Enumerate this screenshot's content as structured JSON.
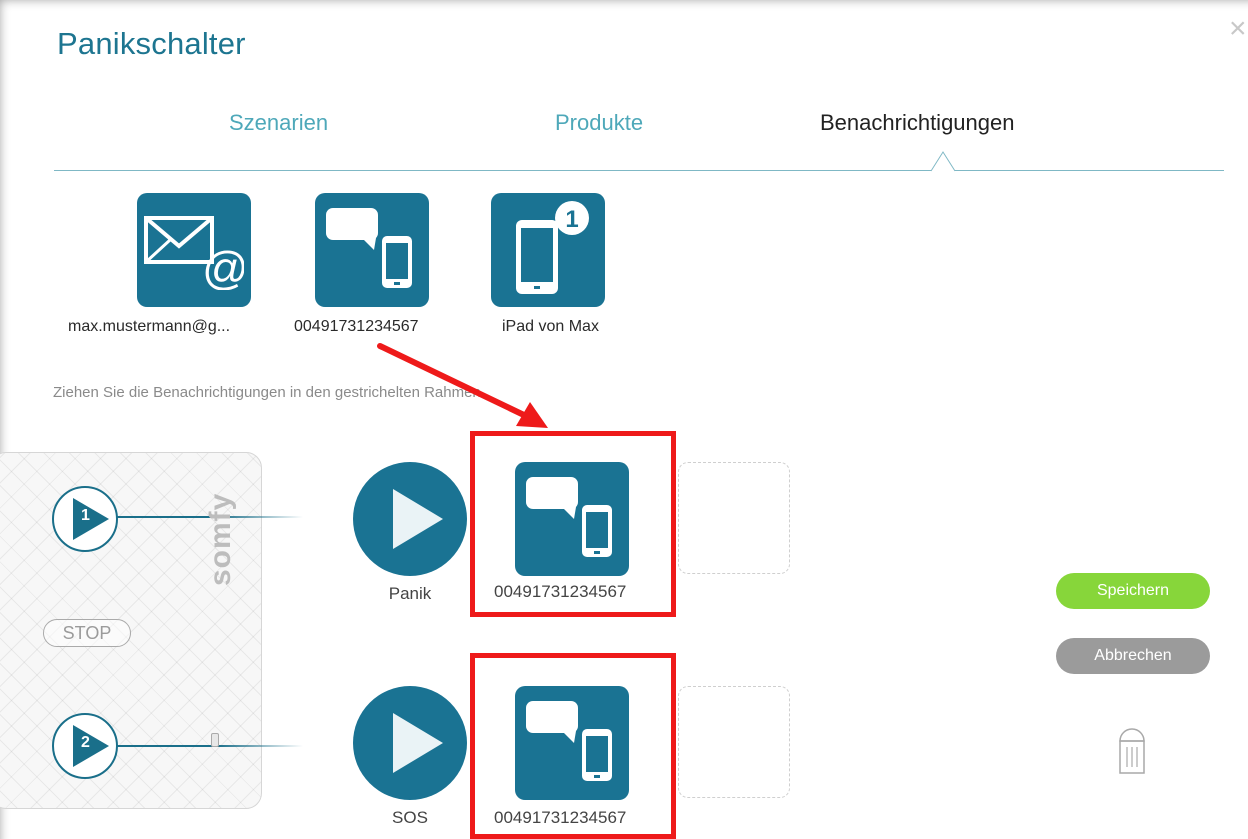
{
  "dialog": {
    "title": "Panikschalter",
    "close_symbol": "×"
  },
  "tabs": [
    {
      "label": "Szenarien",
      "active": false
    },
    {
      "label": "Produkte",
      "active": false
    },
    {
      "label": "Benachrichtigungen",
      "active": true
    }
  ],
  "notifications": [
    {
      "label": "max.mustermann@g...",
      "icon": "email-icon"
    },
    {
      "label": "00491731234567",
      "icon": "sms-phone-icon"
    },
    {
      "label": "iPad von Max",
      "icon": "push-device-icon",
      "badge": "1"
    }
  ],
  "hint": "Ziehen Sie die Benachrichtigungen in den gestrichelten Rahmen.",
  "remote": {
    "brand": "somfy",
    "stop_label": "STOP",
    "button1_number": "1",
    "button2_number": "2"
  },
  "scenarios": [
    {
      "label": "Panik",
      "assigned": "00491731234567"
    },
    {
      "label": "SOS",
      "assigned": "00491731234567"
    }
  ],
  "actions": {
    "save": "Speichern",
    "cancel": "Abbrechen"
  },
  "colors": {
    "accent": "#1a7393",
    "title": "#1d7590",
    "tab_inactive": "#4ea8b9",
    "save": "#87d63a",
    "cancel": "#9b9b9b",
    "highlight": "#ee1a1a"
  }
}
